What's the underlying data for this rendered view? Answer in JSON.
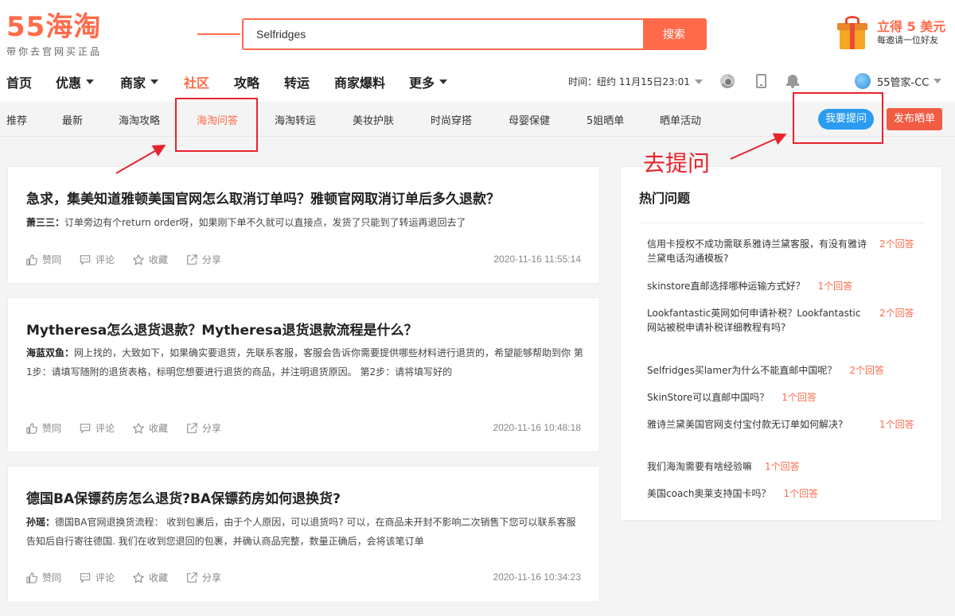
{
  "header": {
    "logo_main": "55海淘",
    "logo_sub": "带你去官网买正品",
    "search_value": "Selfridges",
    "search_button": "搜索",
    "promo_title": "立得 5 美元",
    "promo_sub": "每邀请一位好友"
  },
  "main_nav": {
    "items": [
      "首页",
      "优惠",
      "商家",
      "社区",
      "攻略",
      "转运",
      "商家爆料",
      "更多"
    ],
    "active": "社区",
    "time_label": "时间：纽约 11月15日23:01",
    "user_name": "55管家-CC"
  },
  "sub_nav": {
    "tabs": [
      "推荐",
      "最新",
      "海淘攻略",
      "海淘问答",
      "海淘转运",
      "美妆护肤",
      "时尚穿搭",
      "母婴保健",
      "5姐晒单",
      "晒单活动"
    ],
    "active": "海淘问答",
    "ask_button": "我要提问",
    "post_button": "发布晒单"
  },
  "annotation": {
    "text": "去提问"
  },
  "posts": [
    {
      "title": "急求，集美知道雅顿美国官网怎么取消订单吗？雅顿官网取消订单后多久退款？",
      "author": "萧三三：",
      "excerpt": "订单旁边有个return order呀，如果刚下单不久就可以直接点，发货了只能到了转运再退回去了",
      "like": "赞同",
      "comment": "评论",
      "favorite": "收藏",
      "share": "分享",
      "date": "2020-11-16 11:55:14"
    },
    {
      "title": "Mytheresa怎么退货退款？Mytheresa退货退款流程是什么？",
      "author": "海蓝双鱼：",
      "excerpt": "网上找的，大致如下，如果确实要退货，先联系客服，客服会告诉你需要提供哪些材料进行退货的，希望能够帮助到你 第1步：请填写随附的退货表格，标明您想要进行退货的商品，并注明退货原因。 第2步：请将填写好的",
      "like": "赞同",
      "comment": "评论",
      "favorite": "收藏",
      "share": "分享",
      "date": "2020-11-16 10:48:18"
    },
    {
      "title": "德国BA保镖药房怎么退货?BA保镖药房如何退换货?",
      "author": "孙瑶：",
      "excerpt": "德国BA官网退换货流程： 收到包裹后，由于个人原因，可以退货吗? 可以，在商品未开封不影响二次销售下您可以联系客服告知后自行寄往德国. 我们在收到您退回的包裹，并确认商品完整，数量正确后，会将该笔订单",
      "like": "赞同",
      "comment": "评论",
      "favorite": "收藏",
      "share": "分享",
      "date": "2020-11-16 10:34:23"
    }
  ],
  "sidebar": {
    "title": "热门问题",
    "questions": [
      {
        "text": "信用卡授权不成功需联系雅诗兰黛客服，有没有雅诗兰黛电话沟通模板?",
        "count": "2个回答"
      },
      {
        "text": "skinstore直邮选择哪种运输方式好？",
        "count": "1个回答"
      },
      {
        "text": "Lookfantastic英网如何申请补税？Lookfantastic网站被税申请补税详细教程有吗?",
        "count": "2个回答"
      },
      {
        "text": "Selfridges买lamer为什么不能直邮中国呢？",
        "count": "2个回答"
      },
      {
        "text": "SkinStore可以直邮中国吗？",
        "count": "1个回答"
      },
      {
        "text": "雅诗兰黛美国官网支付宝付款无订单如何解决?",
        "count": "1个回答"
      },
      {
        "text": "我们海淘需要有啥经验嘛",
        "count": "1个回答"
      },
      {
        "text": "美国coach奥莱支持国卡吗？",
        "count": "1个回答"
      }
    ]
  },
  "colors": {
    "brand": "#ff6b4a",
    "ask_button": "#2a9cf0",
    "annotation": "#e8232c"
  }
}
